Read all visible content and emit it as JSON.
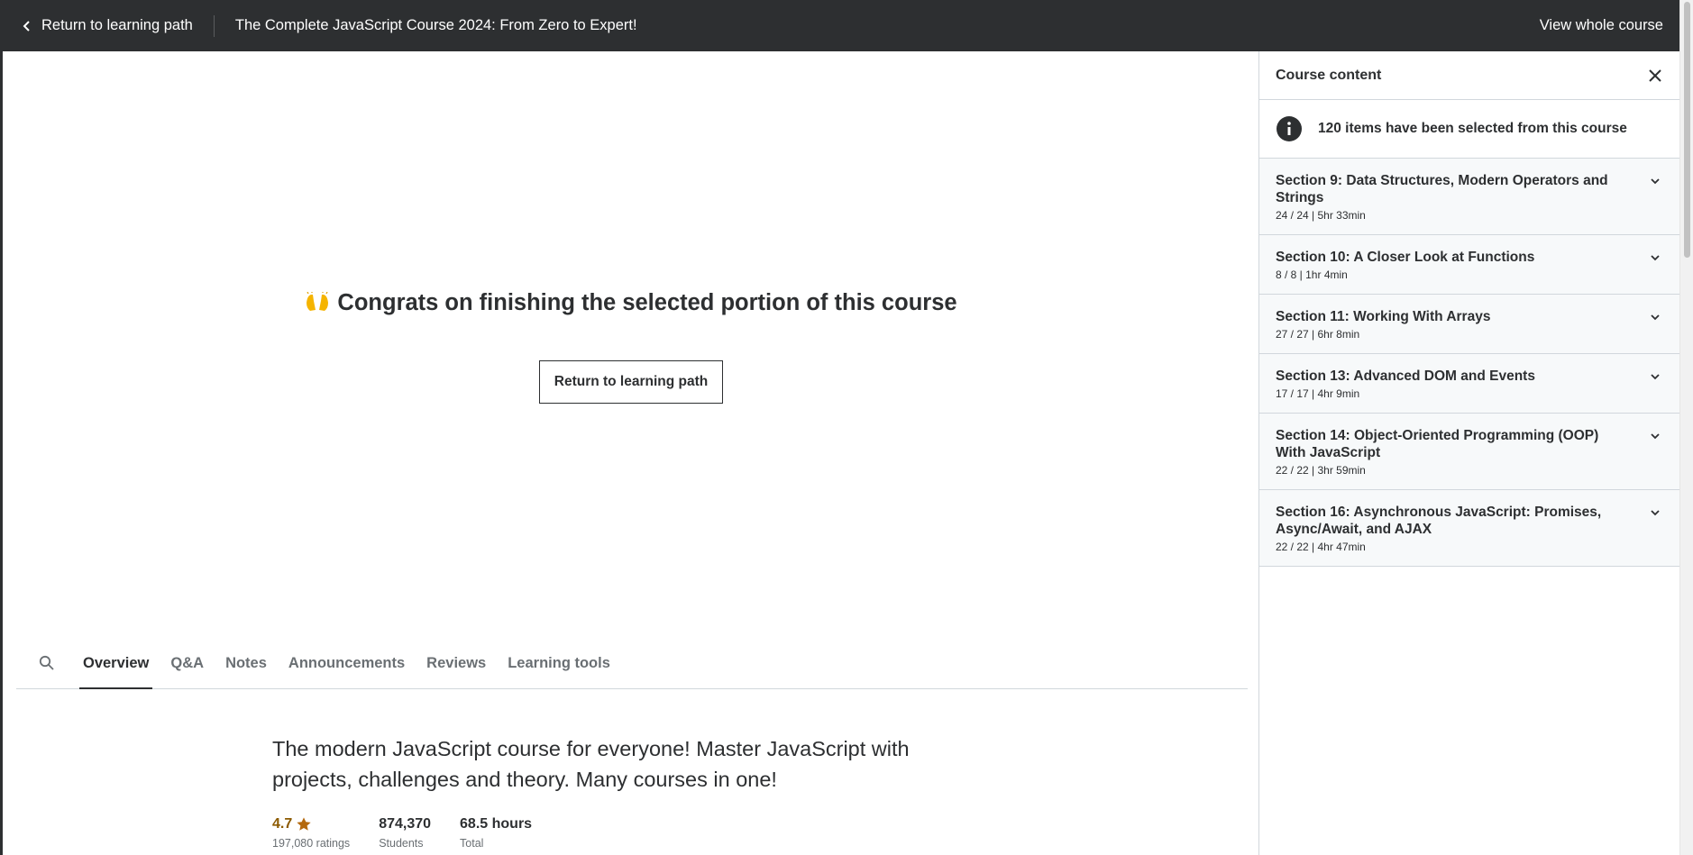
{
  "topbar": {
    "back_label": "Return to learning path",
    "course_title": "The Complete JavaScript Course 2024: From Zero to Expert!",
    "view_whole_label": "View whole course"
  },
  "main": {
    "congrats_text": "Congrats on finishing the selected portion of this course",
    "return_button_label": "Return to learning path"
  },
  "tabs": [
    {
      "label": "Overview",
      "active": true
    },
    {
      "label": "Q&A",
      "active": false
    },
    {
      "label": "Notes",
      "active": false
    },
    {
      "label": "Announcements",
      "active": false
    },
    {
      "label": "Reviews",
      "active": false
    },
    {
      "label": "Learning tools",
      "active": false
    }
  ],
  "overview": {
    "headline": "The modern JavaScript course for everyone! Master JavaScript with projects, challenges and theory. Many courses in one!",
    "rating": {
      "value": "4.7",
      "label": "197,080 ratings"
    },
    "students": {
      "value": "874,370",
      "label": "Students"
    },
    "total": {
      "value": "68.5 hours",
      "label": "Total"
    }
  },
  "sidebar": {
    "title": "Course content",
    "info_text": "120 items have been selected from this course",
    "sections": [
      {
        "title": "Section 9: Data Structures, Modern Operators and Strings",
        "meta": "24 / 24 | 5hr 33min"
      },
      {
        "title": "Section 10: A Closer Look at Functions",
        "meta": "8 / 8 | 1hr 4min"
      },
      {
        "title": "Section 11: Working With Arrays",
        "meta": "27 / 27 | 6hr 8min"
      },
      {
        "title": "Section 13: Advanced DOM and Events",
        "meta": "17 / 17 | 4hr 9min"
      },
      {
        "title": "Section 14: Object-Oriented Programming (OOP) With JavaScript",
        "meta": "22 / 22 | 3hr 59min"
      },
      {
        "title": "Section 16: Asynchronous JavaScript: Promises, Async/Await, and AJAX",
        "meta": "22 / 22 | 4hr 47min"
      }
    ]
  },
  "colors": {
    "topbar_bg": "#2d2f31",
    "rating_color": "#b4690e",
    "section_bg": "#f7f9fa"
  },
  "icons": [
    "chevron-left-icon",
    "search-icon",
    "close-icon",
    "info-icon",
    "star-icon",
    "chevron-down-icon",
    "raising-hands-emoji"
  ]
}
